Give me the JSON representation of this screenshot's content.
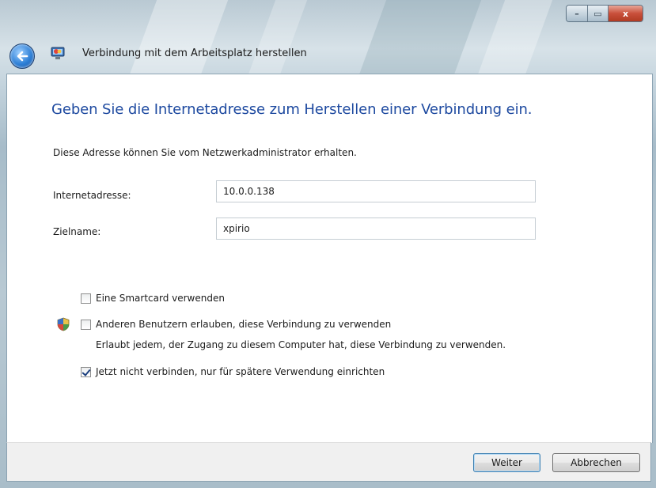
{
  "window": {
    "title": "Verbindung mit dem Arbeitsplatz herstellen",
    "caption_buttons": {
      "minimize_glyph": "–",
      "maximize_glyph": "▭",
      "close_glyph": "x"
    },
    "icons": {
      "back": "back-arrow-icon",
      "app": "remote-desktop-icon",
      "shield": "uac-shield-icon"
    }
  },
  "main": {
    "heading": "Geben Sie die Internetadresse zum Herstellen einer Verbindung ein.",
    "info": "Diese Adresse können Sie vom Netzwerkadministrator erhalten.",
    "address": {
      "label": "Internetadresse:",
      "value": "10.0.0.138"
    },
    "destination": {
      "label": "Zielname:",
      "value": "xpirio"
    },
    "options": {
      "smartcard": {
        "label": "Eine Smartcard verwenden",
        "checked": false
      },
      "allow_others": {
        "label": "Anderen Benutzern erlauben, diese Verbindung zu verwenden",
        "description": "Erlaubt jedem, der Zugang zu diesem Computer hat, diese Verbindung zu verwenden.",
        "checked": false
      },
      "connect_later": {
        "label": "Jetzt nicht verbinden, nur für spätere Verwendung einrichten",
        "checked": true
      }
    }
  },
  "footer": {
    "next_label": "Weiter",
    "cancel_label": "Abbrechen"
  },
  "colors": {
    "heading": "#1e4aa0",
    "close_button": "#c9503b",
    "default_button_border": "#3c7fb1"
  }
}
